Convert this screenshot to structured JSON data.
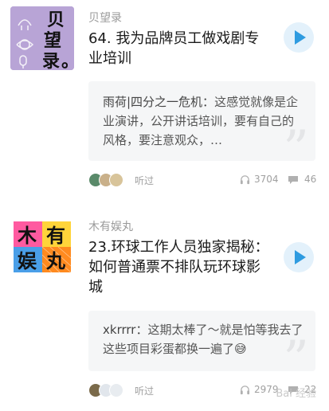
{
  "episodes": [
    {
      "podcast": "贝望录",
      "cover_text": [
        "贝",
        "望",
        "录",
        "。"
      ],
      "title": "64. 我为品牌员工做戏剧专业培训",
      "comment_author": "雨荷|四分之一危机：",
      "comment_text": "这感觉就像是企业演讲，公开讲话培训，要有自己的风格，要注意观众，…",
      "listened": "听过",
      "plays": "3704",
      "comments": "46"
    },
    {
      "podcast": "木有娱丸",
      "cover_text": [
        "木",
        "有",
        "娱",
        "丸"
      ],
      "title": "23.环球工作人员独家揭秘：如何普通票不排队玩环球影城",
      "comment_author": "xkrrrr：",
      "comment_text": "这期太棒了～就是怕等我去了这些项目彩蛋都换一遍了😅",
      "listened": "听过",
      "plays": "2979",
      "comments": "22"
    }
  ],
  "watermark": "Bai 经验",
  "colors": {
    "accent": "#2e9be0",
    "cover1_bg": "#b8a4d6",
    "cover2_pink": "#ff5aa0",
    "cover2_yellow": "#ffd43a",
    "cover2_blue": "#4a9fe8",
    "cover2_orange": "#ff8a1f"
  },
  "icons": [
    "play-icon",
    "headphones-icon",
    "comment-icon",
    "quote-icon"
  ]
}
